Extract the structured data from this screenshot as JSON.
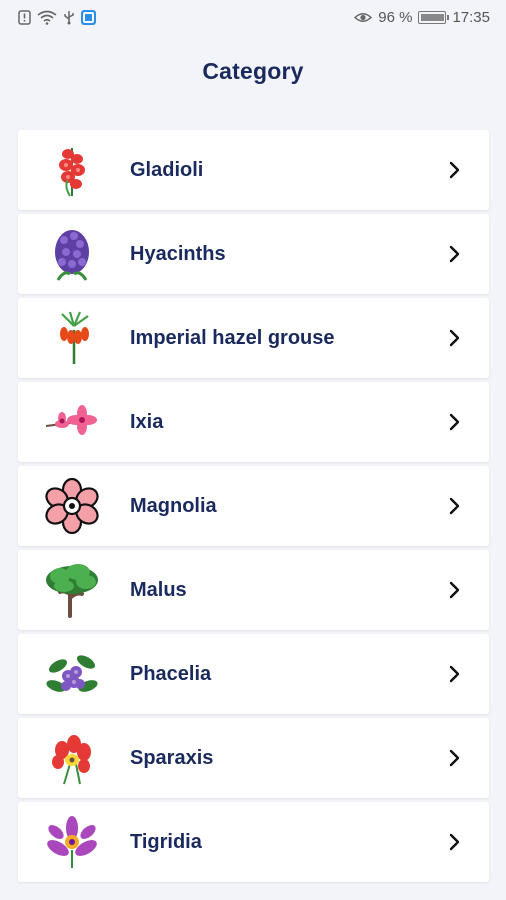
{
  "status": {
    "battery_percent": "96 %",
    "battery_level": 0.96,
    "time": "17:35",
    "icons": [
      "alert-icon",
      "wifi-icon",
      "usb-icon",
      "app-notification-icon",
      "eye-icon",
      "battery-icon"
    ]
  },
  "page": {
    "title": "Category"
  },
  "categories": [
    {
      "label": "Gladioli",
      "icon": "gladiolus-icon"
    },
    {
      "label": "Hyacinths",
      "icon": "hyacinth-icon"
    },
    {
      "label": "Imperial hazel grouse",
      "icon": "imperial-fritillary-icon"
    },
    {
      "label": "Ixia",
      "icon": "ixia-icon"
    },
    {
      "label": "Magnolia",
      "icon": "magnolia-icon"
    },
    {
      "label": "Malus",
      "icon": "malus-tree-icon"
    },
    {
      "label": "Phacelia",
      "icon": "phacelia-icon"
    },
    {
      "label": "Sparaxis",
      "icon": "sparaxis-icon"
    },
    {
      "label": "Tigridia",
      "icon": "tigridia-icon"
    }
  ],
  "colors": {
    "title": "#1b2a5e",
    "background": "#f3f4f9",
    "card": "#ffffff"
  }
}
